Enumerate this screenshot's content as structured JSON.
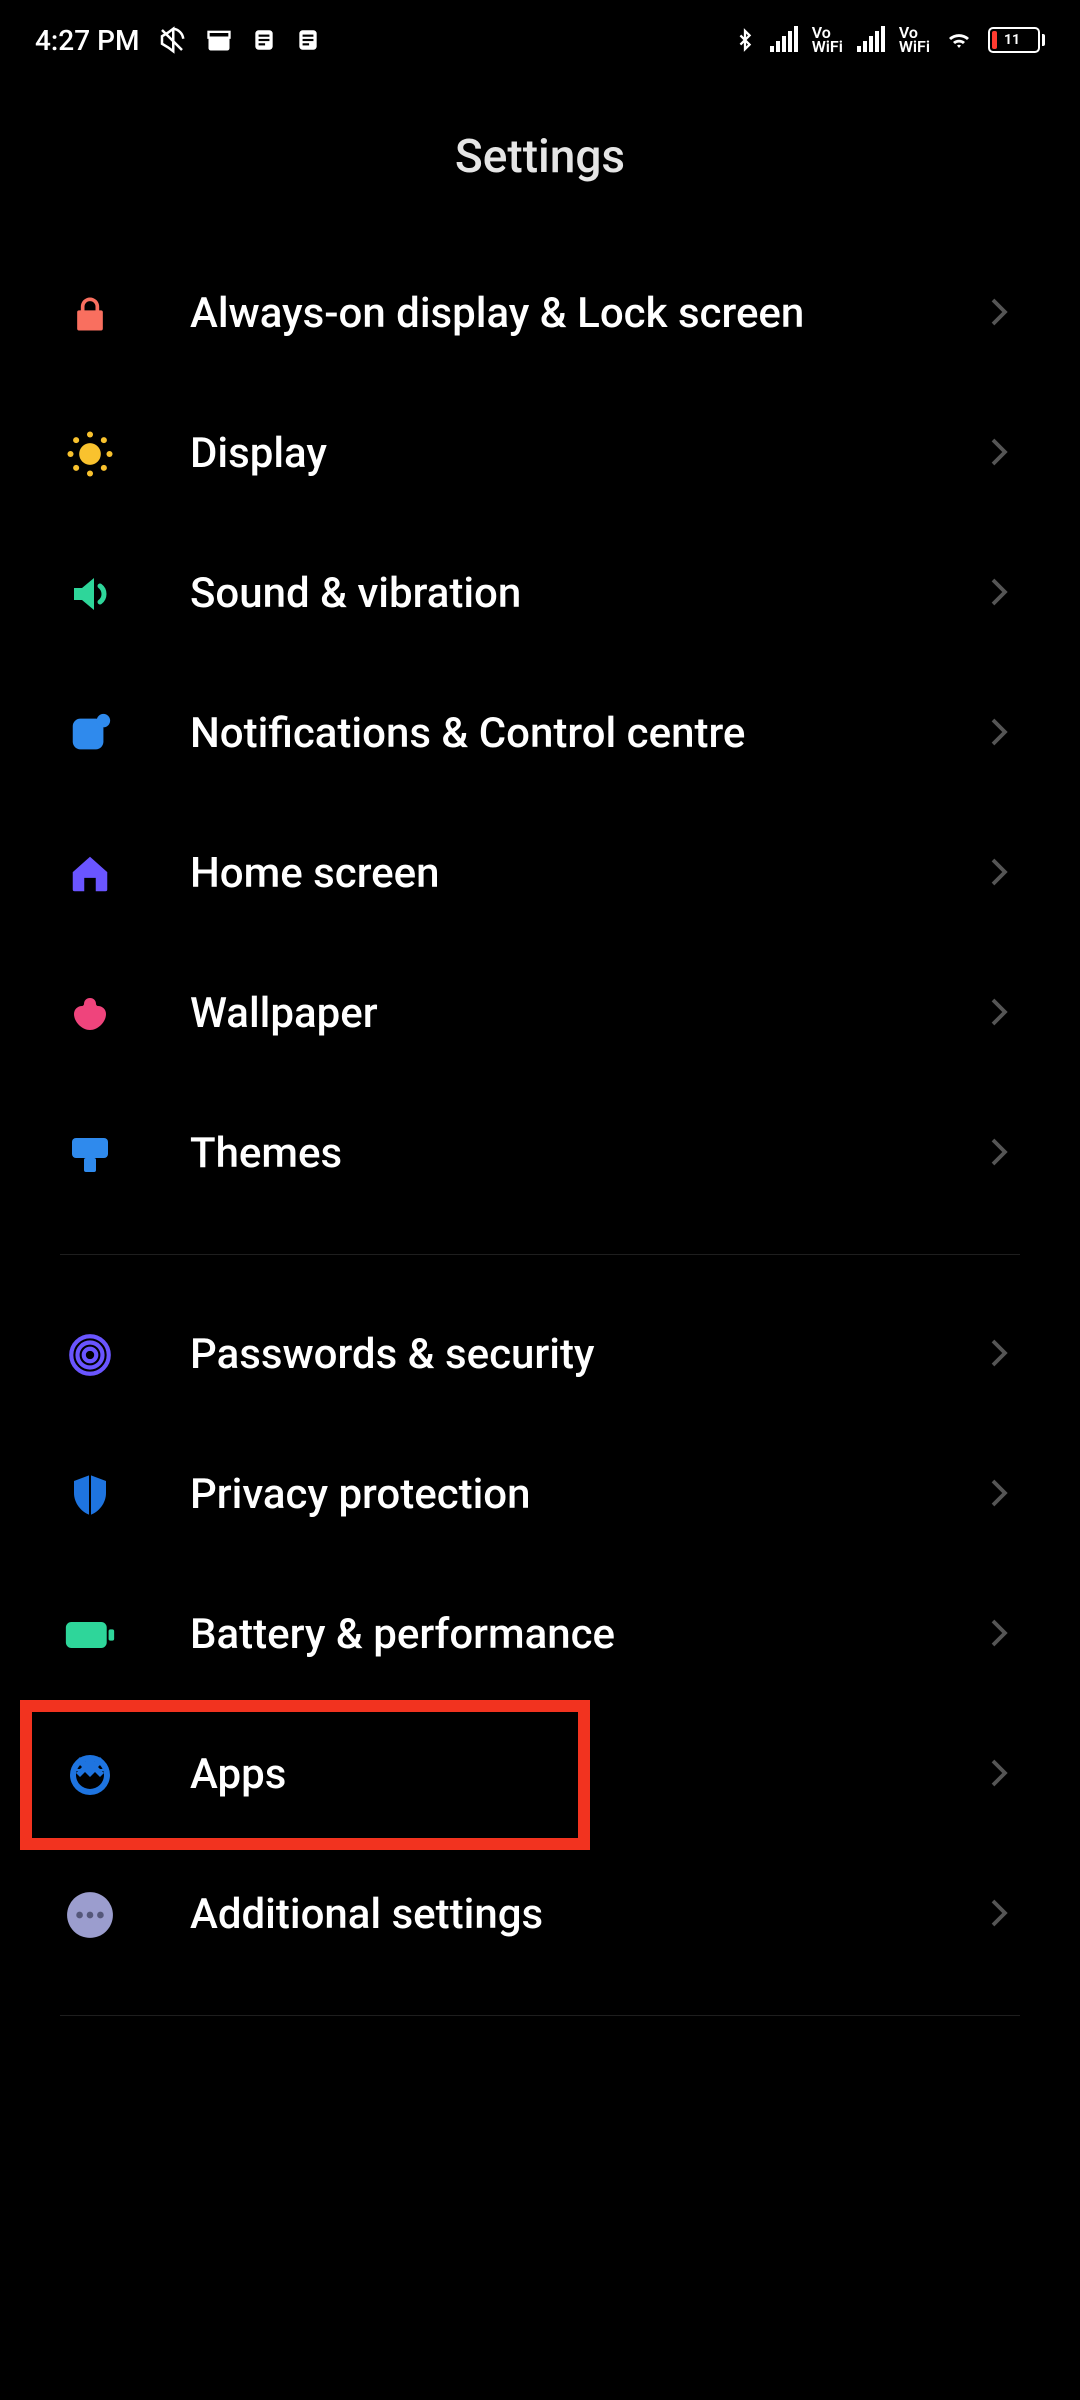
{
  "status": {
    "time": "4:27 PM",
    "battery_percent": "11"
  },
  "header": {
    "title": "Settings"
  },
  "groups": [
    {
      "items": [
        {
          "key": "always-on-display",
          "icon": "lock-icon",
          "label": "Always-on display & Lock screen",
          "color": "#f96f5f"
        },
        {
          "key": "display",
          "icon": "brightness-icon",
          "label": "Display",
          "color": "#f9c22e"
        },
        {
          "key": "sound",
          "icon": "speaker-icon",
          "label": "Sound & vibration",
          "color": "#2ed69a"
        },
        {
          "key": "notifications",
          "icon": "notification-icon",
          "label": "Notifications & Control centre",
          "color": "#2f8aed"
        },
        {
          "key": "home-screen",
          "icon": "home-icon",
          "label": "Home screen",
          "color": "#6a55ff"
        },
        {
          "key": "wallpaper",
          "icon": "wallpaper-icon",
          "label": "Wallpaper",
          "color": "#ef447c"
        },
        {
          "key": "themes",
          "icon": "theme-icon",
          "label": "Themes",
          "color": "#2f8aed"
        }
      ]
    },
    {
      "items": [
        {
          "key": "passwords",
          "icon": "fingerprint-icon",
          "label": "Passwords & security",
          "color": "#6a55ff"
        },
        {
          "key": "privacy",
          "icon": "privacy-icon",
          "label": "Privacy protection",
          "color": "#1e74e0"
        },
        {
          "key": "battery",
          "icon": "battery-icon",
          "label": "Battery & performance",
          "color": "#2ed69a"
        },
        {
          "key": "apps",
          "icon": "apps-icon",
          "label": "Apps",
          "color": "#1e74e0",
          "highlight": true
        },
        {
          "key": "additional",
          "icon": "more-icon",
          "label": "Additional settings",
          "color": "#9b9dce"
        }
      ]
    }
  ]
}
